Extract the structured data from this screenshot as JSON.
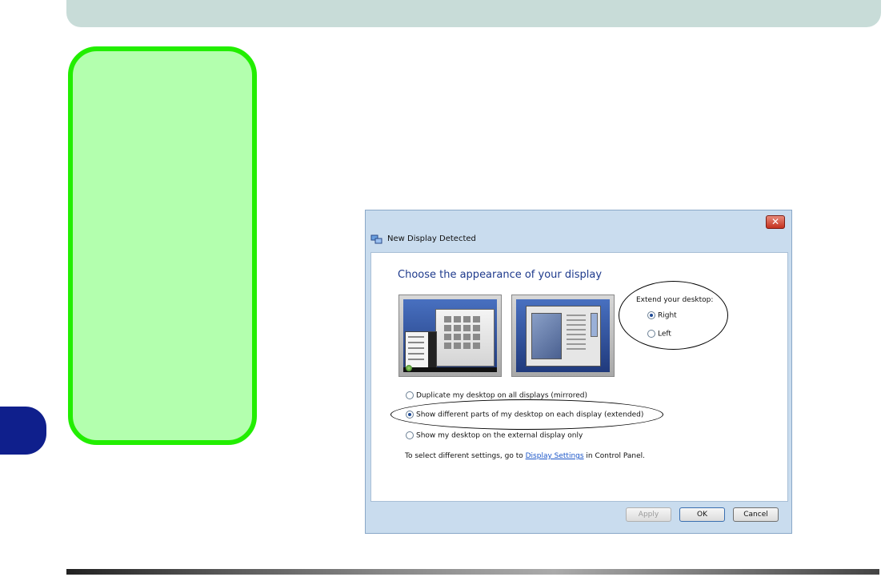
{
  "dialog": {
    "title": "New Display Detected",
    "close_glyph": "✕",
    "heading": "Choose the appearance of your display",
    "extend": {
      "label": "Extend your desktop:",
      "options": [
        {
          "label": "Right",
          "checked": true
        },
        {
          "label": "Left",
          "checked": false
        }
      ]
    },
    "choices": [
      {
        "label": "Duplicate my desktop on all displays (mirrored)",
        "checked": false
      },
      {
        "label": "Show different parts of my desktop on each display (extended)",
        "checked": true
      },
      {
        "label": "Show my desktop on the external display only",
        "checked": false
      }
    ],
    "info": {
      "prefix": "To select different settings, go to ",
      "link": "Display Settings",
      "suffix": " in Control Panel."
    },
    "buttons": {
      "apply": "Apply",
      "ok": "OK",
      "cancel": "Cancel"
    }
  },
  "icons": [
    "display-icon",
    "close-icon",
    "radio-icon"
  ],
  "colors": {
    "green_border": "#22ee00",
    "green_fill": "#b3ffae",
    "tab_blue": "#0f1f8c",
    "top_bar": "#c8dcd8",
    "heading_blue": "#1e3a8c"
  }
}
